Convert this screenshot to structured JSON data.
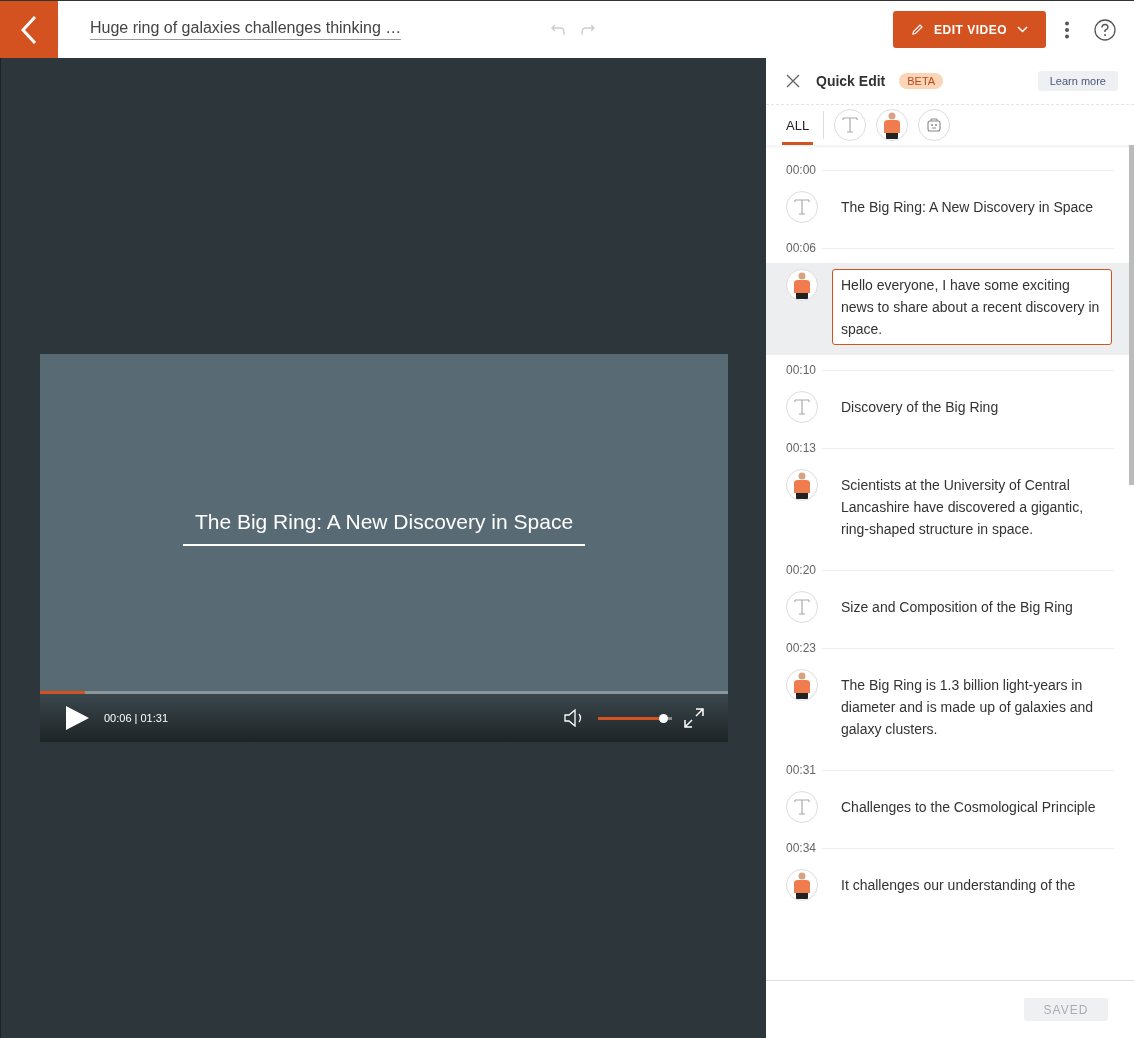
{
  "header": {
    "title": "Huge ring of galaxies challenges thinking …",
    "edit_button": "EDIT VIDEO"
  },
  "video": {
    "caption": "The Big Ring: A New Discovery in Space",
    "progress": {
      "level": 0.065
    },
    "time": "00:06 | 01:31",
    "volume": {
      "level": 1.0
    }
  },
  "panel": {
    "title": "Quick Edit",
    "badge": "BETA",
    "learn_more": "Learn more",
    "filters": [
      {
        "kind": "all",
        "label": "ALL",
        "selected": true
      },
      {
        "kind": "text",
        "selected": false
      },
      {
        "kind": "avatar",
        "selected": false
      },
      {
        "kind": "robot",
        "selected": false
      }
    ],
    "segments": [
      {
        "time": "00:00",
        "kind": "text",
        "text": "The Big Ring: A New Discovery in Space",
        "selected": false
      },
      {
        "time": "00:06",
        "kind": "avatar",
        "text": "Hello everyone, I have some exciting news to share about a recent discovery in space.",
        "selected": true
      },
      {
        "time": "00:10",
        "kind": "text",
        "text": "Discovery of the Big Ring",
        "selected": false
      },
      {
        "time": "00:13",
        "kind": "avatar",
        "text": "Scientists at the University of Central Lancashire have discovered a gigantic, ring-shaped structure in space.",
        "selected": false
      },
      {
        "time": "00:20",
        "kind": "text",
        "text": "Size and Composition of the Big Ring",
        "selected": false
      },
      {
        "time": "00:23",
        "kind": "avatar",
        "text": "The Big Ring is 1.3 billion light-years in diameter and is made up of galaxies and galaxy clusters.",
        "selected": false
      },
      {
        "time": "00:31",
        "kind": "text",
        "text": "Challenges to the Cosmological Principle",
        "selected": false
      },
      {
        "time": "00:34",
        "kind": "avatar",
        "text": "It challenges our understanding of the",
        "selected": false
      }
    ],
    "save_button": {
      "label": "SAVED",
      "disabled": true
    }
  }
}
